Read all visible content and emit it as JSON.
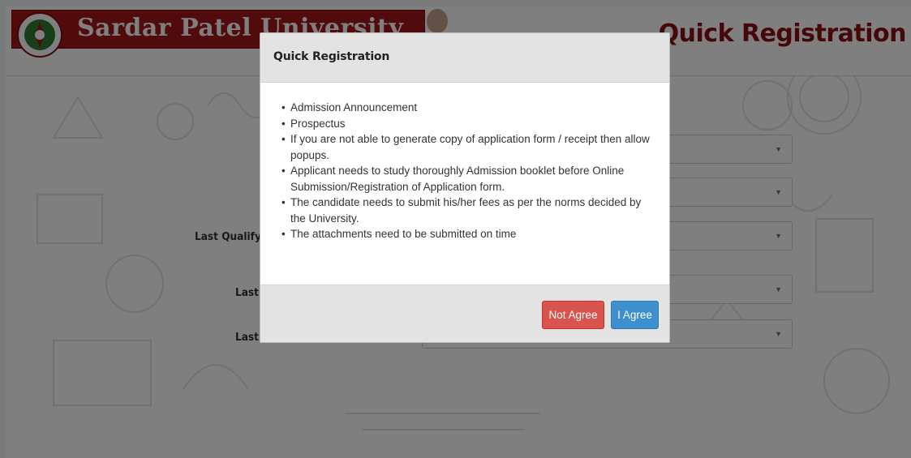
{
  "header": {
    "university_name": "Sardar Patel University",
    "page_heading": "Quick Registration"
  },
  "form": {
    "labels": {
      "last_qualify": "Last Qualify",
      "last_2": "Last",
      "last_3": "Last"
    }
  },
  "modal": {
    "title": "Quick Registration",
    "items": [
      "Admission Announcement",
      "Prospectus",
      "If you are not able to generate copy of application form / receipt then allow popups.",
      "Applicant needs to study thoroughly Admission booklet before Online Submission/Registration of Application form.",
      "The candidate needs to submit his/her fees as per the norms decided by the University.",
      "The attachments need to be submitted on time"
    ],
    "buttons": {
      "not_agree": "Not Agree",
      "agree": "I Agree"
    }
  },
  "colors": {
    "banner": "#a4161a",
    "heading": "#8b0e12",
    "not_agree": "#d9534f",
    "agree": "#3d8fcd"
  },
  "icons": {
    "logo": "university-emblem-icon",
    "caret": "caret-down-icon"
  }
}
